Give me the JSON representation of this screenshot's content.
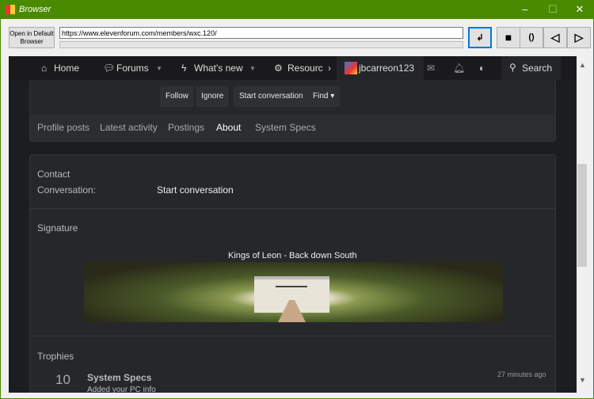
{
  "window": {
    "title": "Browser",
    "minimize": "–",
    "maximize": "☐",
    "close": "✕"
  },
  "toolbar": {
    "open_default": "Open in Default Browser",
    "url": "https://www.elevenforum.com/members/wxc.120/",
    "go": "↲",
    "stop": "■",
    "refresh": "()",
    "back": "◁",
    "forward": "▷"
  },
  "nav": {
    "home": "Home",
    "forums": "Forums",
    "whats_new": "What's new",
    "resources": "Resourc",
    "user": "jbcarreon123",
    "search": "Search"
  },
  "profile": {
    "follow": "Follow",
    "ignore": "Ignore",
    "start_conversation": "Start conversation",
    "find": "Find"
  },
  "tabs": [
    "Profile posts",
    "Latest activity",
    "Postings",
    "About",
    "System Specs"
  ],
  "about": {
    "contact": "Contact",
    "conversation_label": "Conversation:",
    "conversation_link": "Start conversation",
    "signature": "Signature",
    "signature_caption": "Kings of Leon - Back down South",
    "signature_logo": "wxc",
    "trophies": "Trophies"
  },
  "trophy": {
    "points": "10",
    "title": "System Specs",
    "desc": "Added your PC info",
    "time": "27 minutes ago"
  }
}
